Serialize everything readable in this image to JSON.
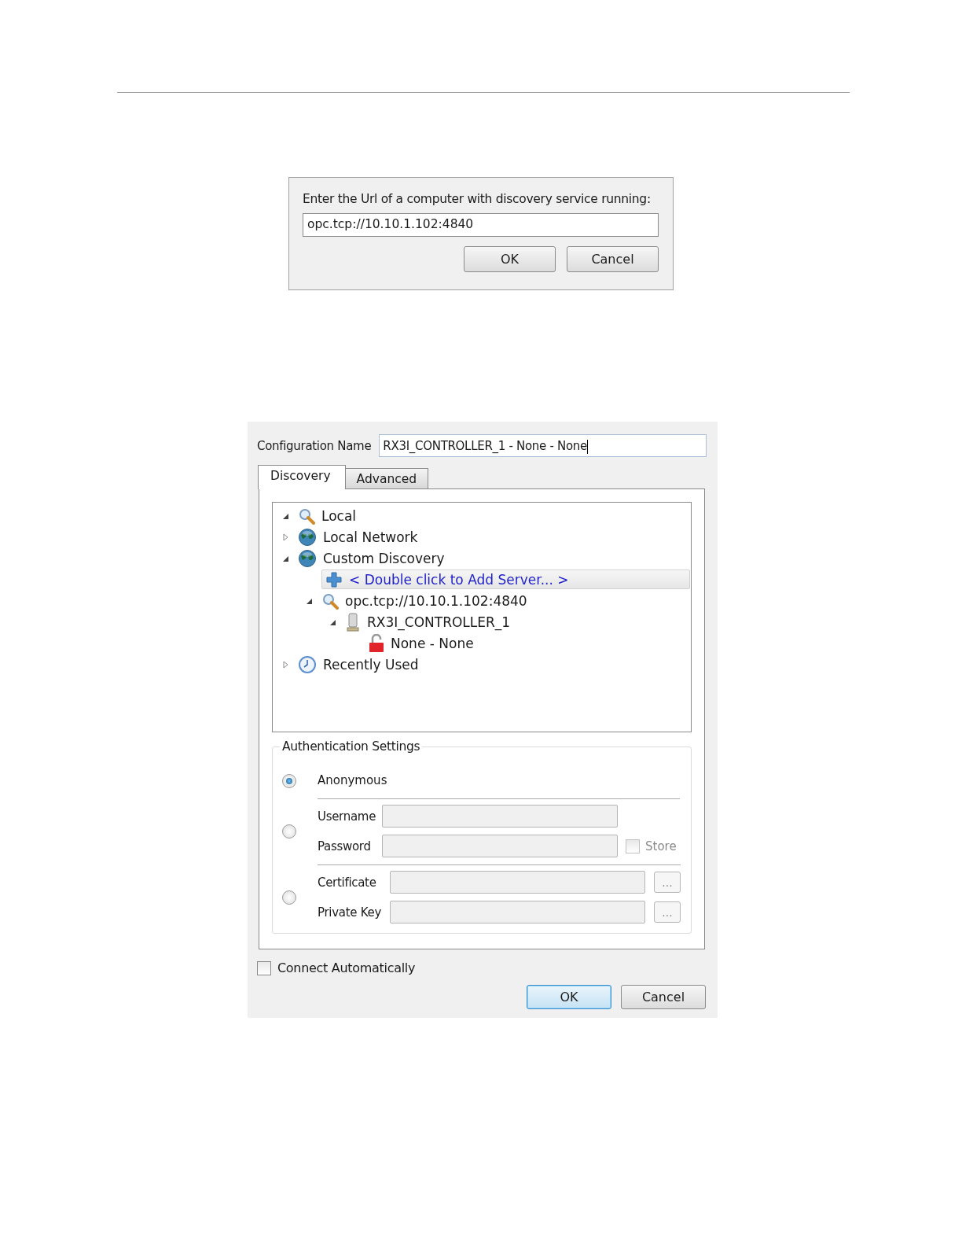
{
  "url_dialog": {
    "prompt": "Enter the Url of a computer with discovery service running:",
    "url": "opc.tcp://10.10.1.102:4840",
    "buttons": [
      {
        "label": "OK",
        "default": false
      },
      {
        "label": "Cancel",
        "default": false
      }
    ]
  },
  "config_dialog": {
    "config_name_label": "Configuration Name",
    "config_name": "RX3I_CONTROLLER_1 - None - None",
    "tabs": [
      {
        "label": "Discovery",
        "selected": true
      },
      {
        "label": "Advanced",
        "selected": false
      }
    ],
    "tree": [
      {
        "kind": "search",
        "label": "Local",
        "expanded": true,
        "selected": false
      },
      {
        "kind": "globe",
        "label": "Local Network",
        "expanded": false,
        "selected": false
      },
      {
        "kind": "globe",
        "label": "Custom Discovery",
        "expanded": true,
        "selected": false,
        "children": [
          {
            "kind": "add",
            "label": "< Double click to Add Server... >",
            "selected": true
          },
          {
            "kind": "search",
            "label": "opc.tcp://10.10.1.102:4840",
            "expanded": true,
            "selected": false,
            "children": [
              {
                "kind": "server",
                "label": "RX3I_CONTROLLER_1",
                "expanded": true,
                "selected": false,
                "children": [
                  {
                    "kind": "lock",
                    "label": "None - None",
                    "selected": false
                  }
                ]
              }
            ]
          }
        ]
      },
      {
        "kind": "clock",
        "label": "Recently Used",
        "expanded": false,
        "selected": false
      }
    ],
    "auth": {
      "title": "Authentication Settings",
      "options": [
        {
          "selected": true,
          "fields": [
            {
              "kind": "plain",
              "label": "Anonymous"
            }
          ]
        },
        {
          "selected": false,
          "fields": [
            {
              "kind": "input",
              "label": "Username",
              "disabled": true
            },
            {
              "kind": "input",
              "label": "Password",
              "disabled": true,
              "store": {
                "label": "Store",
                "checked": false,
                "disabled": true
              }
            }
          ]
        },
        {
          "selected": false,
          "fields": [
            {
              "kind": "input",
              "label": "Certificate",
              "disabled": true,
              "browse": "..."
            },
            {
              "kind": "input",
              "label": "Private Key",
              "disabled": true,
              "browse": "..."
            }
          ]
        }
      ]
    },
    "connect_automatically": {
      "label": "Connect Automatically",
      "checked": false
    },
    "buttons": [
      {
        "label": "OK",
        "default": true
      },
      {
        "label": "Cancel",
        "default": false
      }
    ]
  }
}
